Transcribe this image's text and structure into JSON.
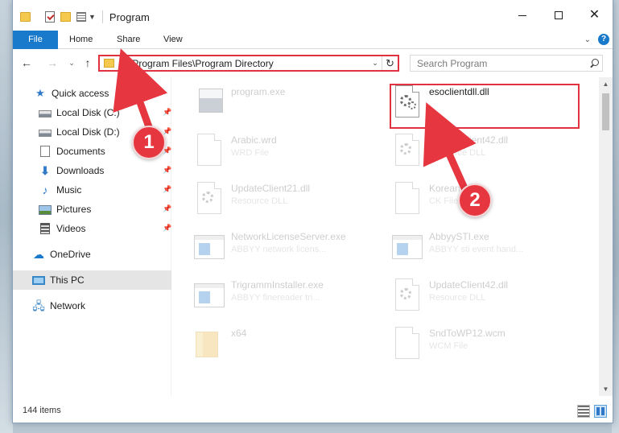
{
  "window": {
    "title": "Program",
    "controls": {
      "minimize_icon": "minimize-icon",
      "maximize_icon": "maximize-icon",
      "close_icon": "close-icon"
    }
  },
  "ribbon": {
    "tabs": [
      {
        "label": "File",
        "active": true
      },
      {
        "label": "Home"
      },
      {
        "label": "Share"
      },
      {
        "label": "View"
      }
    ],
    "help_label": "?"
  },
  "navbar": {
    "address": "C:\\Program Files\\Program Directory",
    "search_placeholder": "Search Program"
  },
  "sidebar": {
    "items": [
      {
        "label": "Quick access",
        "icon": "star-icon",
        "pinned": false
      },
      {
        "label": "Local Disk (C:)",
        "icon": "disk-icon",
        "pinned": true
      },
      {
        "label": "Local Disk (D:)",
        "icon": "disk-icon",
        "pinned": true
      },
      {
        "label": "Documents",
        "icon": "documents-icon",
        "pinned": true
      },
      {
        "label": "Downloads",
        "icon": "downloads-icon",
        "pinned": true
      },
      {
        "label": "Music",
        "icon": "music-icon",
        "pinned": true
      },
      {
        "label": "Pictures",
        "icon": "pictures-icon",
        "pinned": true
      },
      {
        "label": "Videos",
        "icon": "videos-icon",
        "pinned": true
      },
      {
        "label": "OneDrive",
        "icon": "onedrive-icon"
      },
      {
        "label": "This PC",
        "icon": "computer-icon",
        "selected": true
      },
      {
        "label": "Network",
        "icon": "network-icon"
      }
    ]
  },
  "files": [
    {
      "name": "program.exe",
      "type": "",
      "icon": "program-icon",
      "faded": true
    },
    {
      "name": "esoclientdll.dll",
      "type": "",
      "icon": "dll-gear-icon",
      "faded": false,
      "highlighted": true
    },
    {
      "name": "Arabic.wrd",
      "type": "WRD File",
      "icon": "document-icon",
      "faded": true
    },
    {
      "name": "UpdateClient42.dll",
      "type": "Resource DLL",
      "icon": "dll-gear-icon",
      "faded": true
    },
    {
      "name": "UpdateClient21.dll",
      "type": "Resource DLL",
      "icon": "dll-gear-icon",
      "faded": true
    },
    {
      "name": "Korean",
      "type": "CK File",
      "icon": "document-icon",
      "faded": true
    },
    {
      "name": "NetworkLicenseServer.exe",
      "type": "ABBYY network licens...",
      "icon": "exe-icon",
      "faded": true
    },
    {
      "name": "AbbyySTI.exe",
      "type": "ABBYY sti event hand...",
      "icon": "exe-icon",
      "faded": true
    },
    {
      "name": "TrigrammInstaller.exe",
      "type": "ABBYY finereader tri...",
      "icon": "exe-icon",
      "faded": true
    },
    {
      "name": "UpdateClient42.dll",
      "type": "Resource DLL",
      "icon": "dll-gear-icon",
      "faded": true
    },
    {
      "name": "x64",
      "type": "",
      "icon": "folder-icon",
      "faded": true
    },
    {
      "name": "SndToWP12.wcm",
      "type": "WCM File",
      "icon": "document-icon",
      "faded": true
    }
  ],
  "status": {
    "item_count": "144 items"
  },
  "annotations": [
    {
      "label": "1"
    },
    {
      "label": "2"
    }
  ],
  "colors": {
    "accent": "#1979ca",
    "annotation_red": "#e0323f"
  }
}
